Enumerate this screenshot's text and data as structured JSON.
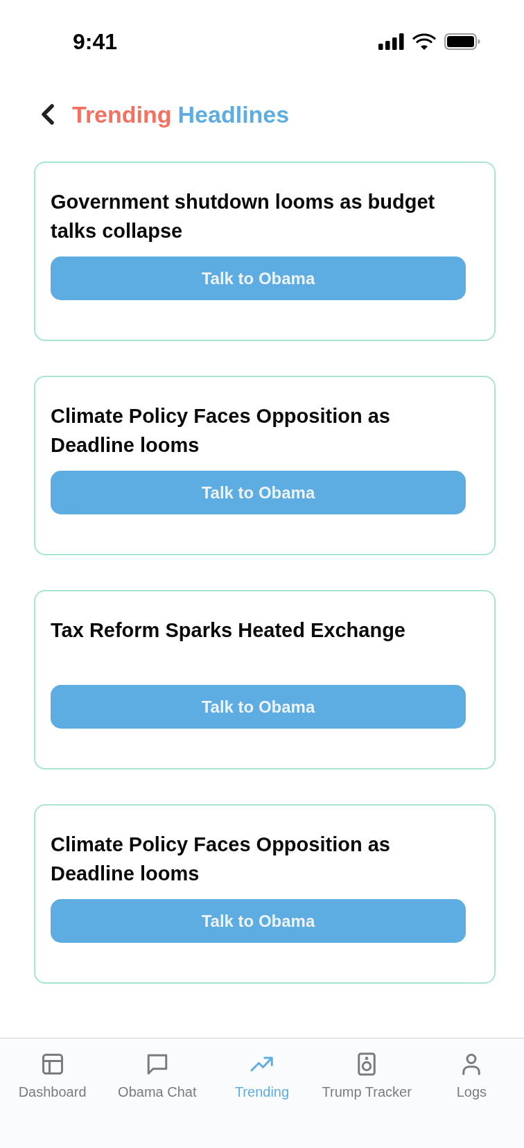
{
  "status_bar": {
    "time": "9:41"
  },
  "header": {
    "title_words": [
      {
        "text": "Trending",
        "color": "#f47162"
      },
      {
        "text": "Headlines",
        "color": "#5dade2"
      }
    ]
  },
  "headlines": [
    {
      "title": "Government shutdown looms as budget talks collapse",
      "button": "Talk to Obama"
    },
    {
      "title": "Climate Policy Faces Opposition as Deadline looms",
      "button": "Talk to Obama"
    },
    {
      "title": "Tax Reform Sparks Heated Exchange",
      "button": "Talk to Obama"
    },
    {
      "title": "Climate Policy Faces Opposition as Deadline looms",
      "button": "Talk to Obama"
    }
  ],
  "bottom_nav": [
    {
      "label": "Dashboard",
      "selected": false
    },
    {
      "label": "Obama Chat",
      "selected": false
    },
    {
      "label": "Trending",
      "selected": true
    },
    {
      "label": "Trump Tracker",
      "selected": false
    },
    {
      "label": "Logs",
      "selected": false
    }
  ]
}
